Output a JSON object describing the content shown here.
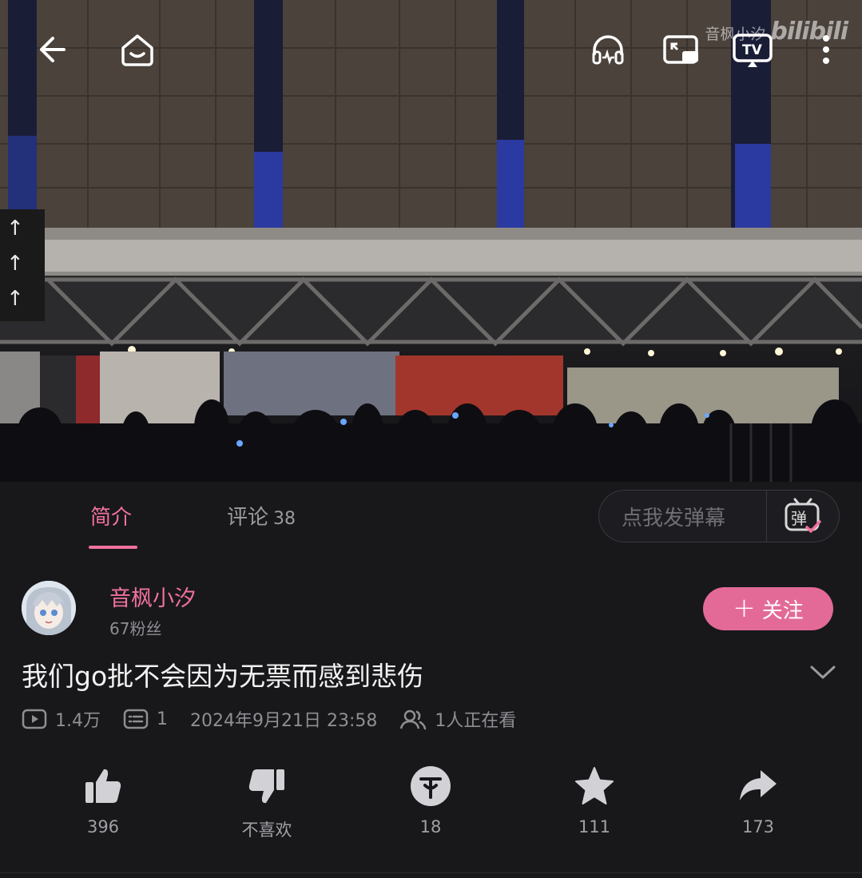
{
  "watermark": {
    "uploader": "音枫小汐",
    "logo": "bilibili"
  },
  "topbar": {
    "back_icon": "arrow-left-icon",
    "home_icon": "home-icon",
    "audio_icon": "headphones-icon",
    "pip_icon": "picture-in-picture-icon",
    "tv_icon": "tv-cast-icon",
    "more_icon": "more-vertical-icon"
  },
  "tabs": {
    "intro_label": "简介",
    "comments_label": "评论",
    "comments_count": "38"
  },
  "danmaku": {
    "placeholder": "点我发弹幕",
    "button_glyph": "弹"
  },
  "uploader": {
    "name": "音枫小汐",
    "fans": "67粉丝",
    "follow_label": "关注"
  },
  "video": {
    "title": "我们go批不会因为无票而感到悲伤",
    "views": "1.4万",
    "danmaku_count": "1",
    "publish_time": "2024年9月21日 23:58",
    "watching": "1人正在看"
  },
  "actions": {
    "like": "396",
    "dislike": "不喜欢",
    "coin": "18",
    "favorite": "111",
    "share": "173"
  },
  "colors": {
    "accent": "#f0719e",
    "follow_bg": "#e36a97",
    "background": "#18181b"
  }
}
